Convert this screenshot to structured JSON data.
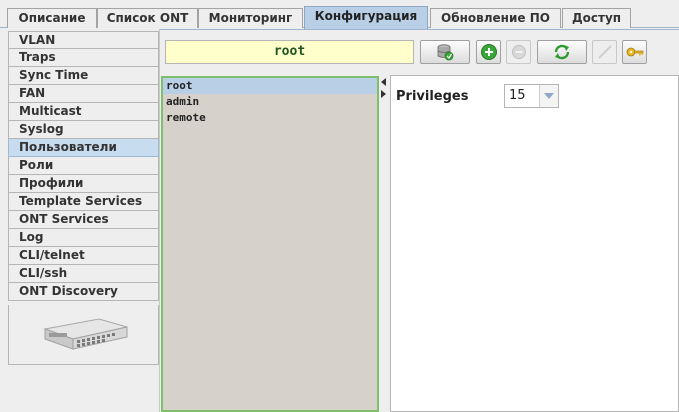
{
  "tabs": [
    {
      "label": "Описание"
    },
    {
      "label": "Список ONT"
    },
    {
      "label": "Мониторинг"
    },
    {
      "label": "Конфигурация"
    },
    {
      "label": "Обновление ПО"
    },
    {
      "label": "Доступ"
    }
  ],
  "active_tab": "Конфигурация",
  "sidebar": {
    "items": [
      {
        "label": "VLAN"
      },
      {
        "label": "Traps"
      },
      {
        "label": "Sync Time"
      },
      {
        "label": "FAN"
      },
      {
        "label": "Multicast"
      },
      {
        "label": "Syslog"
      },
      {
        "label": "Пользователи"
      },
      {
        "label": "Роли"
      },
      {
        "label": "Профили"
      },
      {
        "label": "Template Services"
      },
      {
        "label": "ONT Services"
      },
      {
        "label": "Log"
      },
      {
        "label": "CLI/telnet"
      },
      {
        "label": "CLI/ssh"
      },
      {
        "label": "ONT Discovery"
      }
    ],
    "active_item": "Пользователи"
  },
  "toolbar": {
    "name_field_value": "root",
    "buttons": [
      {
        "icon": "database-save-icon"
      },
      {
        "icon": "add-icon"
      },
      {
        "icon": "remove-icon"
      },
      {
        "icon": "refresh-icon"
      },
      {
        "icon": "edit-icon"
      },
      {
        "icon": "key-icon"
      }
    ]
  },
  "users": {
    "items": [
      {
        "name": "root"
      },
      {
        "name": "admin"
      },
      {
        "name": "remote"
      }
    ],
    "selected": "root"
  },
  "details": {
    "privileges_label": "Privileges",
    "privileges_value": "15"
  },
  "colors": {
    "active_tab": "#b8cfe5",
    "name_field_bg": "#ffffcc",
    "list_border": "#7fbf6a",
    "list_bg": "#d6d1cb",
    "add_green": "#3aa63a"
  }
}
